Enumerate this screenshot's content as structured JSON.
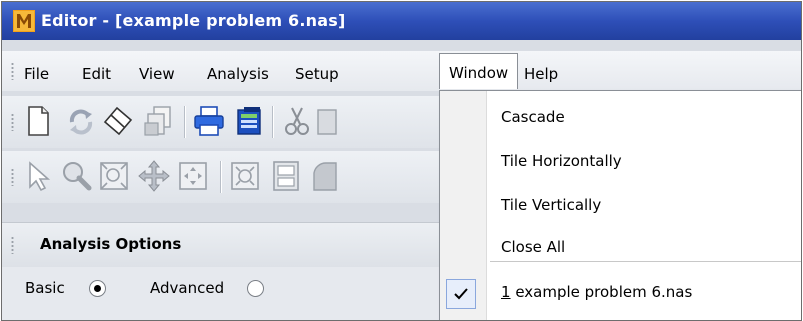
{
  "window": {
    "title": "Editor - [example problem 6.nas]",
    "app_icon": "app-logo-icon",
    "title_bar_color": "#2e4fb8"
  },
  "menubar": {
    "items": [
      {
        "label": "File"
      },
      {
        "label": "Edit"
      },
      {
        "label": "View"
      },
      {
        "label": "Analysis"
      },
      {
        "label": "Setup"
      },
      {
        "label": "Window",
        "open": true
      },
      {
        "label": "Help"
      }
    ]
  },
  "toolbar1": {
    "icons": [
      "new-document-icon",
      "refresh-icon",
      "erase-icon",
      "copy-pages-icon",
      "print-icon",
      "print-preview-icon",
      "cut-icon",
      "paste-icon"
    ]
  },
  "toolbar2": {
    "icons": [
      "pointer-icon",
      "zoom-icon",
      "zoom-fit-icon",
      "pan-icon",
      "move-icon",
      "zoom-extents-icon",
      "filmstrip-icon",
      "shape-icon"
    ]
  },
  "panel": {
    "title": "Analysis Options",
    "basic_label": "Basic",
    "advanced_label": "Advanced",
    "selected_mode": "Basic"
  },
  "window_menu": {
    "items": [
      {
        "label": "Cascade"
      },
      {
        "label": "Tile Horizontally"
      },
      {
        "label": "Tile Vertically"
      },
      {
        "label": "Close All"
      }
    ],
    "open_window": {
      "mnemonic": "1",
      "label": " example problem 6.nas",
      "checked": true,
      "check_icon": "checkmark-icon"
    }
  }
}
